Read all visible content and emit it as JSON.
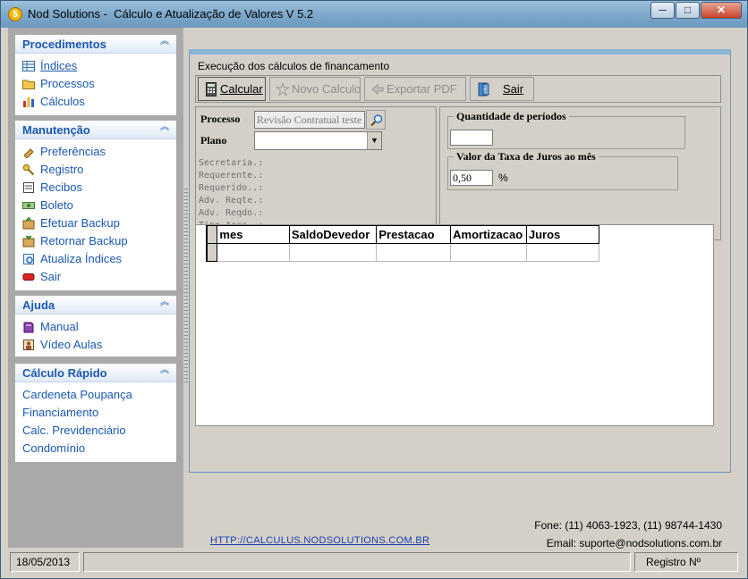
{
  "window": {
    "title": "Nod Solutions -  Cálculo e Atualização de Valores V 5.2",
    "app_icon": "dollar-coin-icon",
    "min_label": "─",
    "max_label": "□",
    "close_label": "✕"
  },
  "sidebar": {
    "groups": [
      {
        "title": "Procedimentos",
        "items": [
          {
            "label": "Índices",
            "icon": "table-icon"
          },
          {
            "label": "Processos",
            "icon": "folder-icon"
          },
          {
            "label": "Cálculos",
            "icon": "bar-chart-icon"
          }
        ]
      },
      {
        "title": "Manutenção",
        "items": [
          {
            "label": "Preferências",
            "icon": "tools-icon"
          },
          {
            "label": "Registro",
            "icon": "key-icon"
          },
          {
            "label": "Recibos",
            "icon": "receipt-icon"
          },
          {
            "label": "Boleto",
            "icon": "money-icon"
          },
          {
            "label": "Efetuar Backup",
            "icon": "backup-box-icon"
          },
          {
            "label": "Retornar Backup",
            "icon": "restore-box-icon"
          },
          {
            "label": "Atualiza Índices",
            "icon": "update-icon"
          },
          {
            "label": "Sair",
            "icon": "exit-icon"
          }
        ]
      },
      {
        "title": "Ajuda",
        "items": [
          {
            "label": "Manual",
            "icon": "book-icon"
          },
          {
            "label": "Vídeo Aulas",
            "icon": "video-icon"
          }
        ]
      },
      {
        "title": "Cálculo Rápido",
        "items": [
          {
            "label": "Cardeneta Poupança"
          },
          {
            "label": "Financiamento"
          },
          {
            "label": "Calc. Previdenciário"
          },
          {
            "label": "Condomínio"
          }
        ]
      }
    ]
  },
  "form": {
    "caption": "Execução dos cálculos de financamento",
    "toolbar": {
      "calcular": "Calcular",
      "novo_calculo": "Novo Calculo",
      "exportar_pdf": "Exportar PDF",
      "sair": "Sair"
    },
    "processo_label": "Processo",
    "processo_value": "Revisão Contratual teste",
    "plano_label": "Plano",
    "plano_value": "",
    "details": [
      "Secretaria.:",
      "Requerente.:",
      "Requerido..:",
      "Adv. Reqte.:",
      "Adv. Reqdo.:",
      "Tipo Acao..:"
    ],
    "quantidade_label": "Quantidade de períodos",
    "quantidade_value": "",
    "taxa_label": "Valor da Taxa de Juros ao mês",
    "taxa_value": "0,50",
    "taxa_unit": "%",
    "grid": {
      "columns": [
        "mes",
        "SaldoDevedor",
        "Prestacao",
        "Amortizacao",
        "Juros"
      ]
    }
  },
  "footer": {
    "link": "HTTP://CALCULUS.NODSOLUTIONS.COM.BR",
    "fone": "Fone: (11) 4063-1923, (11) 98744-1430",
    "email": "Email: suporte@nodsolutions.com.br"
  },
  "statusbar": {
    "date": "18/05/2013",
    "middle": "",
    "registro": "Registro Nº"
  },
  "colors": {
    "sidebar_link": "#1b58b0",
    "title_bar": "#7ea9cb",
    "sidebar_bg": "#a9a9a9"
  }
}
